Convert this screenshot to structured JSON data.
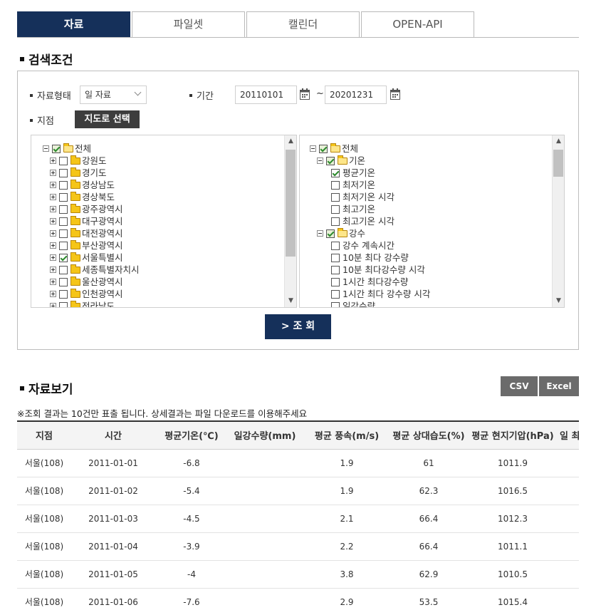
{
  "tabs": [
    {
      "label": "자료",
      "active": true
    },
    {
      "label": "파일셋",
      "active": false
    },
    {
      "label": "캘린더",
      "active": false
    },
    {
      "label": "OPEN-API",
      "active": false
    }
  ],
  "search": {
    "title": "검색조건",
    "data_type_label": "자료형태",
    "data_type_value": "일 자료",
    "period_label": "기간",
    "start_date": "20110101",
    "period_separator": "~",
    "end_date": "20201231",
    "station_label": "지점",
    "map_button": "지도로 선택",
    "query_button": "> 조 회",
    "station_tree": [
      {
        "label": "전체",
        "level": 0,
        "expand": "minus",
        "check": "part"
      },
      {
        "label": "강원도",
        "level": 1,
        "expand": "plus",
        "check": "none"
      },
      {
        "label": "경기도",
        "level": 1,
        "expand": "plus",
        "check": "none"
      },
      {
        "label": "경상남도",
        "level": 1,
        "expand": "plus",
        "check": "none"
      },
      {
        "label": "경상북도",
        "level": 1,
        "expand": "plus",
        "check": "none"
      },
      {
        "label": "광주광역시",
        "level": 1,
        "expand": "plus",
        "check": "none"
      },
      {
        "label": "대구광역시",
        "level": 1,
        "expand": "plus",
        "check": "none"
      },
      {
        "label": "대전광역시",
        "level": 1,
        "expand": "plus",
        "check": "none"
      },
      {
        "label": "부산광역시",
        "level": 1,
        "expand": "plus",
        "check": "none"
      },
      {
        "label": "서울특별시",
        "level": 1,
        "expand": "plus",
        "check": "checked"
      },
      {
        "label": "세종특별자치시",
        "level": 1,
        "expand": "plus",
        "check": "none"
      },
      {
        "label": "울산광역시",
        "level": 1,
        "expand": "plus",
        "check": "none"
      },
      {
        "label": "인천광역시",
        "level": 1,
        "expand": "plus",
        "check": "none"
      },
      {
        "label": "전라남도",
        "level": 1,
        "expand": "plus",
        "check": "none"
      }
    ],
    "element_tree": [
      {
        "label": "전체",
        "level": 0,
        "expand": "minus",
        "check": "part",
        "folder": true
      },
      {
        "label": "기온",
        "level": 1,
        "expand": "minus",
        "check": "part",
        "folder": true
      },
      {
        "label": "평균기온",
        "level": 2,
        "check": "checked"
      },
      {
        "label": "최저기온",
        "level": 2,
        "check": "none"
      },
      {
        "label": "최저기온 시각",
        "level": 2,
        "check": "none"
      },
      {
        "label": "최고기온",
        "level": 2,
        "check": "none"
      },
      {
        "label": "최고기온 시각",
        "level": 2,
        "check": "none"
      },
      {
        "label": "강수",
        "level": 1,
        "expand": "minus",
        "check": "part",
        "folder": true
      },
      {
        "label": "강수 계속시간",
        "level": 2,
        "check": "none"
      },
      {
        "label": "10분 최다 강수량",
        "level": 2,
        "check": "none"
      },
      {
        "label": "10분 최다강수량 시각",
        "level": 2,
        "check": "none"
      },
      {
        "label": "1시간 최다강수량",
        "level": 2,
        "check": "none"
      },
      {
        "label": "1시간 최다 강수량 시각",
        "level": 2,
        "check": "none"
      },
      {
        "label": "일강수량",
        "level": 2,
        "check": "none"
      }
    ]
  },
  "results": {
    "title": "자료보기",
    "csv_button": "CSV",
    "excel_button": "Excel",
    "note": "※조회 결과는 10건만 표출 됩니다. 상세결과는 파일 다운로드를 이용해주세요",
    "columns": [
      "지점",
      "시간",
      "평균기온(℃)",
      "일강수량(mm)",
      "평균 풍속(m/s)",
      "평균 상대습도(%)",
      "평균 현지기압(hPa)",
      "일 최심신적설(cm)"
    ],
    "rows": [
      [
        "서울(108)",
        "2011-01-01",
        "-6.8",
        "",
        "1.9",
        "61",
        "1011.9",
        ""
      ],
      [
        "서울(108)",
        "2011-01-02",
        "-5.4",
        "",
        "1.9",
        "62.3",
        "1016.5",
        ""
      ],
      [
        "서울(108)",
        "2011-01-03",
        "-4.5",
        "",
        "2.1",
        "66.4",
        "1012.3",
        ""
      ],
      [
        "서울(108)",
        "2011-01-04",
        "-3.9",
        "",
        "2.2",
        "66.4",
        "1011.1",
        ""
      ],
      [
        "서울(108)",
        "2011-01-05",
        "-4",
        "",
        "3.8",
        "62.9",
        "1010.5",
        ""
      ],
      [
        "서울(108)",
        "2011-01-06",
        "-7.6",
        "",
        "2.9",
        "53.5",
        "1015.4",
        ""
      ]
    ]
  }
}
